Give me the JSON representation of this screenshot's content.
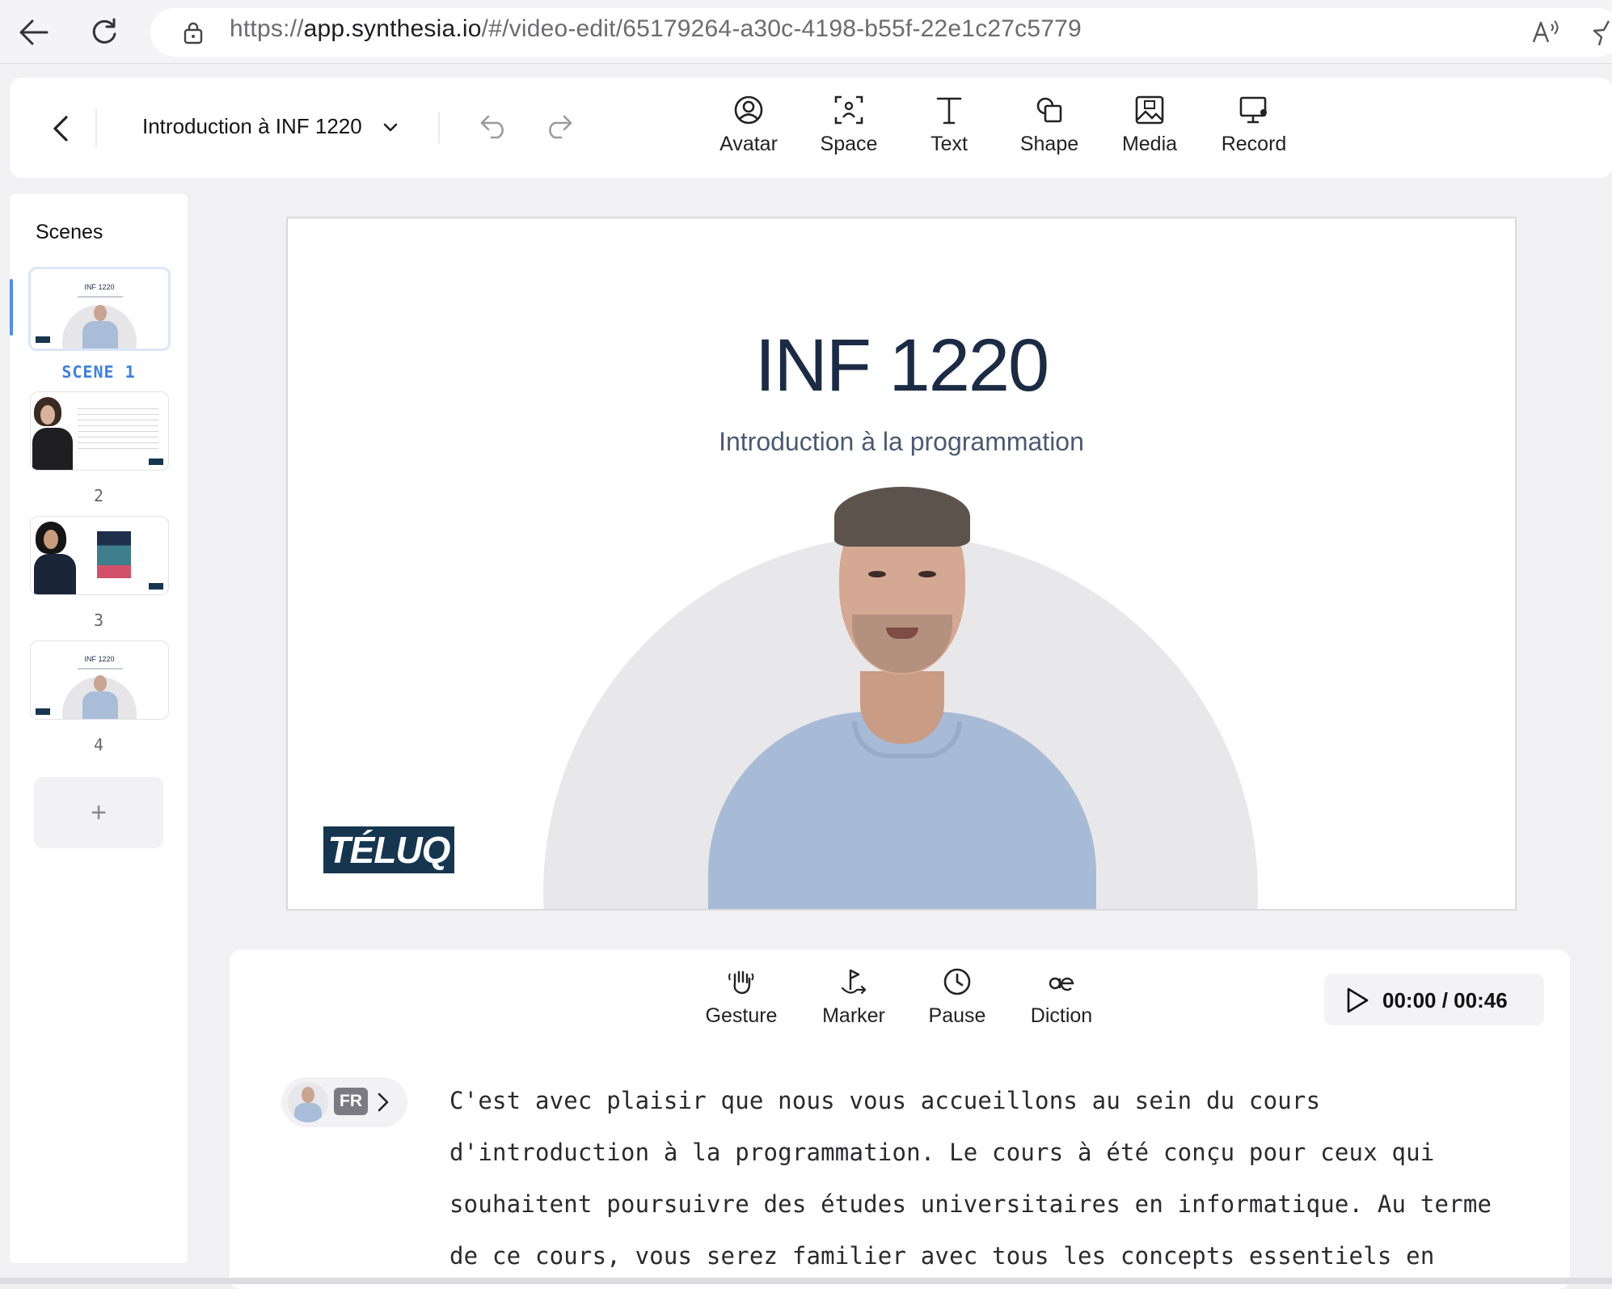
{
  "browser": {
    "url_scheme": "https://",
    "url_host": "app.synthesia.io",
    "url_path": "/#/video-edit/65179264-a30c-4198-b55f-22e1c27c5779"
  },
  "toolbar": {
    "project_title": "Introduction à INF 1220",
    "tools": [
      {
        "label": "Avatar",
        "icon": "avatar-icon"
      },
      {
        "label": "Space",
        "icon": "space-icon"
      },
      {
        "label": "Text",
        "icon": "text-icon"
      },
      {
        "label": "Shape",
        "icon": "shape-icon"
      },
      {
        "label": "Media",
        "icon": "media-icon"
      },
      {
        "label": "Record",
        "icon": "record-icon"
      }
    ]
  },
  "scenes": {
    "title": "Scenes",
    "items": [
      {
        "label": "SCENE 1",
        "active": true,
        "thumb_title": "INF 1220"
      },
      {
        "label": "2",
        "active": false
      },
      {
        "label": "3",
        "active": false
      },
      {
        "label": "4",
        "active": false,
        "thumb_title": "INF 1220"
      }
    ],
    "add_label": "+"
  },
  "slide": {
    "title": "INF 1220",
    "subtitle": "Introduction à la programmation",
    "logo_text": "TÉLUQ"
  },
  "script_tools": [
    {
      "label": "Gesture",
      "icon": "gesture-icon"
    },
    {
      "label": "Marker",
      "icon": "marker-icon"
    },
    {
      "label": "Pause",
      "icon": "pause-clock-icon"
    },
    {
      "label": "Diction",
      "icon": "diction-icon"
    }
  ],
  "player": {
    "time": "00:00 / 00:46"
  },
  "speaker": {
    "language": "FR"
  },
  "script": {
    "lines": [
      "C'est avec plaisir que nous vous accueillons au sein du cours",
      "d'introduction à la programmation. Le cours à été conçu pour ceux qui",
      "souhaitent poursuivre des études universitaires en informatique. Au terme",
      "de ce cours, vous serez familier avec tous les concepts essentiels en"
    ]
  },
  "colors": {
    "accent": "#3d7fe0",
    "slide_title": "#1c2b45",
    "logo_bg": "#163650"
  }
}
